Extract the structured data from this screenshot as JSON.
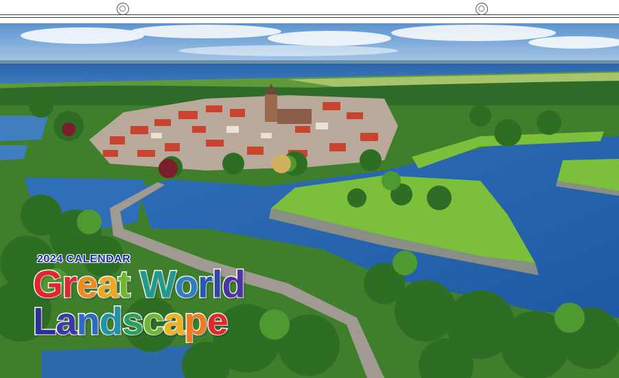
{
  "calendar": {
    "year_label": "2024 CALENDAR",
    "title_line1": [
      "G",
      "r",
      "e",
      "a",
      "t",
      " ",
      "W",
      "o",
      "r",
      "l",
      "d"
    ],
    "title_line2": [
      "L",
      "a",
      "n",
      "d",
      "s",
      "c",
      "a",
      "p",
      "e"
    ],
    "line1_colors": [
      "#e3262b",
      "#e3262b",
      "#f08a1c",
      "#f2a81a",
      "#6fb82e",
      "#ffffff",
      "#1f9a8e",
      "#2c7fc0",
      "#2459b5",
      "#3346a8",
      "#4a34a0"
    ],
    "line2_colors": [
      "#2b2f96",
      "#3a3aa6",
      "#2c6cc0",
      "#1f93a8",
      "#2aa15a",
      "#6fb82e",
      "#f2b21a",
      "#f07a1c",
      "#e3262b"
    ]
  },
  "binding": {
    "hole_icon": "ring-hole-icon"
  },
  "photo": {
    "subject": "aerial-fortress-town-icon"
  }
}
